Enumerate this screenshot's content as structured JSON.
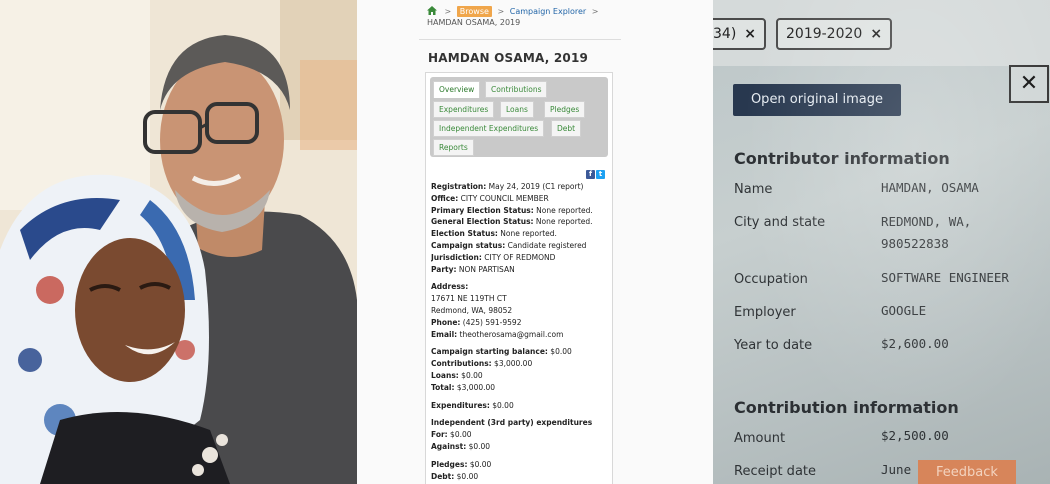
{
  "photo": {
    "description_icon": "selfie-photo"
  },
  "web": {
    "breadcrumb": {
      "sep1": ">",
      "browse": "Browse",
      "sep2": ">",
      "explorer": "Campaign Explorer",
      "sep3": ">",
      "current": "HAMDAN OSAMA, 2019"
    },
    "title": "HAMDAN OSAMA, 2019",
    "tabs": [
      "Overview",
      "Contributions",
      "Expenditures",
      "Loans",
      "Pledges",
      "Independent Expenditures",
      "Debt",
      "Reports"
    ],
    "social": {
      "facebook": "f",
      "twitter": "t"
    },
    "details": {
      "registration_label": "Registration:",
      "registration_value": " May 24, 2019 (C1 report)",
      "office_label": "Office:",
      "office_value": " CITY COUNCIL MEMBER",
      "primary_label": "Primary Election Status:",
      "primary_value": " None reported.",
      "general_label": "General Election Status:",
      "general_value": " None reported.",
      "election_label": "Election Status:",
      "election_value": " None reported.",
      "campaign_label": "Campaign status:",
      "campaign_value": " Candidate registered",
      "jurisdiction_label": "Jurisdiction:",
      "jurisdiction_value": " CITY OF REDMOND",
      "party_label": "Party:",
      "party_value": " NON PARTISAN",
      "address_label": "Address:",
      "address_line1": "17671 NE 119TH CT",
      "address_line2": "Redmond, WA, 98052",
      "phone_label": "Phone:",
      "phone_value": " (425) 591-9592",
      "email_label": "Email:",
      "email_value": " theotherosama@gmail.com",
      "starting_label": "Campaign starting balance:",
      "starting_value": " $0.00",
      "contributions_label": "Contributions:",
      "contributions_value": " $3,000.00",
      "loans_label": "Loans:",
      "loans_value": " $0.00",
      "total_label": "Total:",
      "total_value": " $3,000.00",
      "expenditures_label": "Expenditures:",
      "expenditures_value": " $0.00",
      "independent_label": "Independent (3rd party) expenditures",
      "for_label": "For:",
      "for_value": " $0.00",
      "against_label": "Against:",
      "against_value": " $0.00",
      "pledges_label": "Pledges:",
      "pledges_value": " $0.00",
      "debt_label": "Debt:",
      "debt_value": " $0.00"
    }
  },
  "screen": {
    "chip1": "34)",
    "chip2": "2019-2020",
    "chip_close": "×",
    "close_button": "✕",
    "open_button": "Open original image",
    "contributor_heading": "Contributor information",
    "name_label": "Name",
    "name_value": "HAMDAN, OSAMA",
    "city_label": "City and state",
    "city_value_line1": "REDMOND, WA,",
    "city_value_line2": "980522838",
    "occupation_label": "Occupation",
    "occupation_value": "SOFTWARE ENGINEER",
    "employer_label": "Employer",
    "employer_value": "GOOGLE",
    "ytd_label": "Year to date",
    "ytd_value": "$2,600.00",
    "contribution_heading": "Contribution information",
    "amount_label": "Amount",
    "amount_value": "$2,500.00",
    "receipt_label": "Receipt date",
    "receipt_value": "June",
    "feedback_button": "Feedback"
  }
}
